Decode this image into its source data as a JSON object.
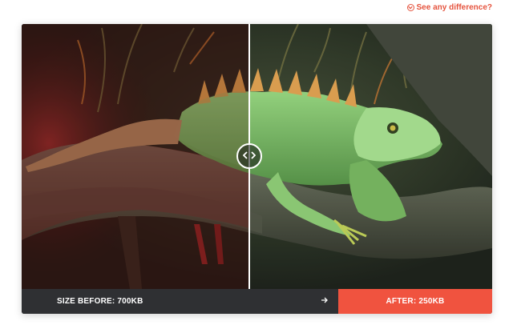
{
  "header": {
    "compare_link_label": "See any difference?",
    "compare_link_icon": "chevron-down-circle-icon"
  },
  "comparison": {
    "image_subject": "photo",
    "handle_icon": "left-right-arrows-icon",
    "size_before_label": "SIZE BEFORE: 700KB",
    "arrow_icon": "arrow-right-icon",
    "size_after_label": "AFTER: 250KB"
  },
  "colors": {
    "accent": "#f0533f",
    "bar_dark": "#2f3033"
  }
}
